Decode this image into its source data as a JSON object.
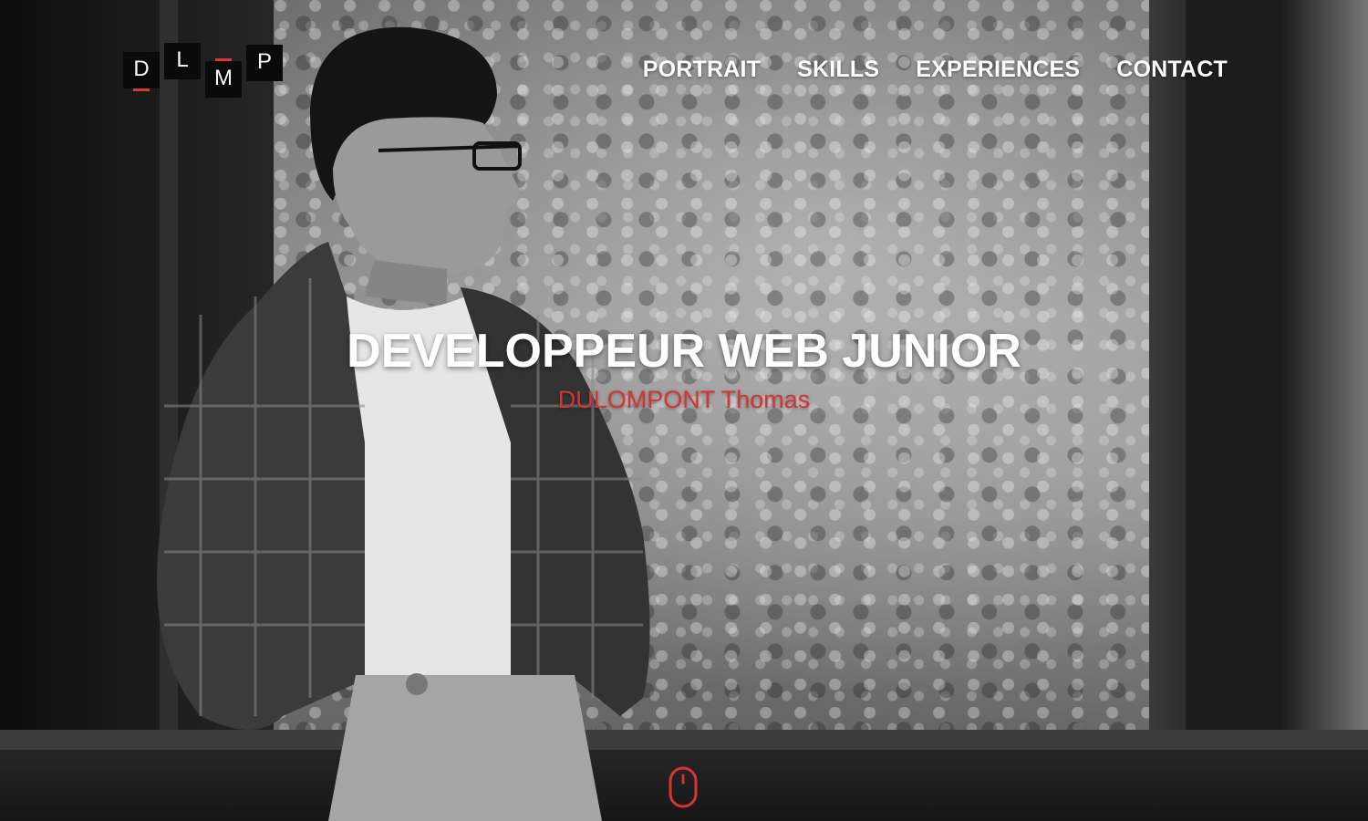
{
  "logo": {
    "letters": [
      "D",
      "L",
      "M",
      "P"
    ],
    "accent_color": "#d83a3a"
  },
  "nav": {
    "items": [
      {
        "label": "PORTRAIT"
      },
      {
        "label": "SKILLS"
      },
      {
        "label": "EXPERIENCES"
      },
      {
        "label": "CONTACT"
      }
    ]
  },
  "hero": {
    "title": "DEVELOPPEUR WEB JUNIOR",
    "subtitle": "DULOMPONT Thomas",
    "title_color": "#ffffff",
    "subtitle_color": "#d53434"
  },
  "scroll_indicator": {
    "icon": "mouse-scroll-icon",
    "color": "#d53434"
  }
}
